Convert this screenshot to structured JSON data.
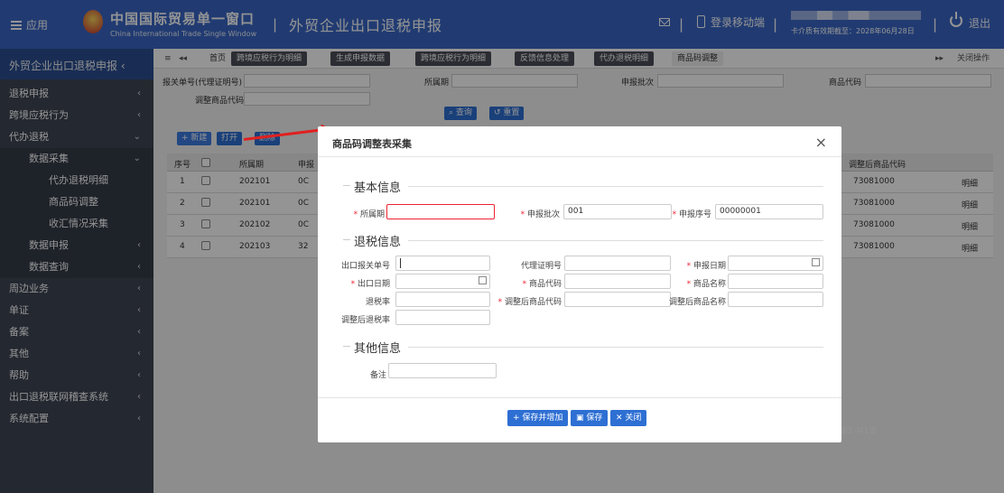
{
  "topbar": {
    "menu_label": "应用",
    "brand_cn": "中国国际贸易单一窗口",
    "brand_en": "China International Trade Single Window",
    "sep": "|",
    "title": "外贸企业出口退税申报",
    "mobile_label": "登录移动端",
    "valid_text": "卡介质有效期截至：2028年06月28日",
    "exit_label": "退出"
  },
  "sidebar": {
    "header": "外贸企业出口退税申报",
    "items": [
      {
        "label": "退税申报",
        "indent": 0,
        "chev": "‹"
      },
      {
        "label": "跨境应税行为",
        "indent": 0,
        "chev": "‹"
      },
      {
        "label": "代办退税",
        "indent": 0,
        "chev": "⌄"
      },
      {
        "label": "数据采集",
        "indent": 1,
        "chev": "⌄"
      },
      {
        "label": "代办退税明细",
        "indent": 2,
        "chev": ""
      },
      {
        "label": "商品码调整",
        "indent": 2,
        "chev": ""
      },
      {
        "label": "收汇情况采集",
        "indent": 2,
        "chev": ""
      },
      {
        "label": "数据申报",
        "indent": 1,
        "chev": "‹"
      },
      {
        "label": "数据查询",
        "indent": 1,
        "chev": "‹"
      },
      {
        "label": "周边业务",
        "indent": 0,
        "chev": "‹"
      },
      {
        "label": "单证",
        "indent": 0,
        "chev": "‹"
      },
      {
        "label": "备案",
        "indent": 0,
        "chev": "‹"
      },
      {
        "label": "其他",
        "indent": 0,
        "chev": "‹"
      },
      {
        "label": "帮助",
        "indent": 0,
        "chev": "‹"
      },
      {
        "label": "出口退税联网稽查系统",
        "indent": 0,
        "chev": "‹"
      },
      {
        "label": "系统配置",
        "indent": 0,
        "chev": "‹"
      }
    ]
  },
  "tabs": {
    "home": "首页",
    "items": [
      "跨境应税行为明细",
      "生成申报数据",
      "跨境应税行为明细",
      "反馈信息处理",
      "代办退税明细",
      "商品码调整"
    ],
    "close_ops": "关闭操作"
  },
  "search": {
    "bg_no_label": "报关单号(代理证明号)",
    "period_label": "所属期",
    "batch_label": "申报批次",
    "goods_code_label": "商品代码",
    "adj_code_label": "调整商品代码",
    "query_btn": "查询",
    "reset_btn": "重置"
  },
  "toolbar": {
    "new": "新建",
    "open": "打开",
    "delete": "删除"
  },
  "grid": {
    "headers": [
      "序号",
      "所属期",
      "申报",
      "调整后商品代码"
    ],
    "rows": [
      {
        "seq": "1",
        "period": "202101",
        "col": "0C",
        "code": "73081000",
        "act": "明细"
      },
      {
        "seq": "2",
        "period": "202101",
        "col": "0C",
        "code": "73081000",
        "act": "明细"
      },
      {
        "seq": "3",
        "period": "202102",
        "col": "0C",
        "code": "73081000",
        "act": "明细"
      },
      {
        "seq": "4",
        "period": "202103",
        "col": "32",
        "code": "73081000",
        "act": "明细"
      }
    ]
  },
  "pager": {
    "page": "第1",
    "total": "共1页"
  },
  "modal": {
    "title": "商品码调整表采集",
    "close": "×",
    "sec_basic": "基本信息",
    "sec_refund": "退税信息",
    "sec_other": "其他信息",
    "f_period": "所属期",
    "f_batch": "申报批次",
    "v_batch": "001",
    "f_seq": "申报序号",
    "v_seq": "00000001",
    "f_bg_no": "出口报关单号",
    "f_agent_no": "代理证明号",
    "f_decl_date": "申报日期",
    "f_exp_date": "出口日期",
    "f_goods_code": "商品代码",
    "f_goods_name": "商品名称",
    "f_rate": "退税率",
    "f_adj_code": "调整后商品代码",
    "f_adj_name": "调整后商品名称",
    "f_adj_rate": "调整后退税率",
    "f_remark": "备注",
    "btn_save_add": "保存并增加",
    "btn_save": "保存",
    "btn_close": "关闭"
  },
  "colors": {
    "brand": "#3a66c4",
    "sidebar": "#3e4654",
    "primary_btn": "#2e6fd3",
    "required": "#e23"
  }
}
